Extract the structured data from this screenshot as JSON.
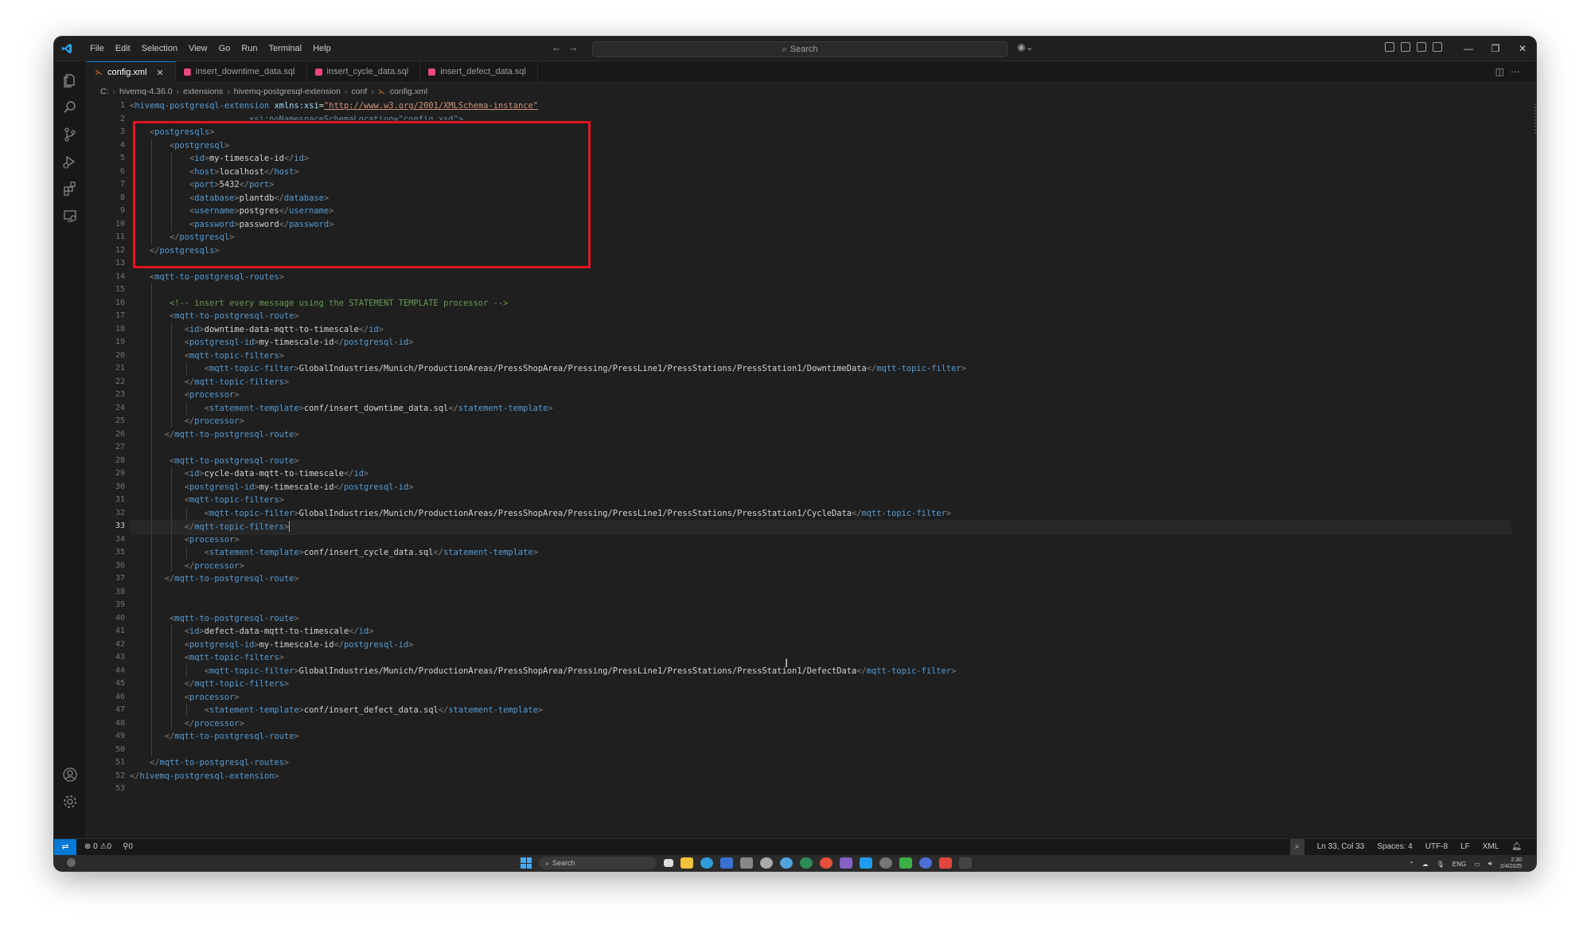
{
  "menu": [
    "File",
    "Edit",
    "Selection",
    "View",
    "Go",
    "Run",
    "Terminal",
    "Help"
  ],
  "search": {
    "label": "Search"
  },
  "tabs": [
    {
      "label": "config.xml",
      "type": "xml",
      "active": true
    },
    {
      "label": "insert_downtime_data.sql",
      "type": "sql",
      "active": false
    },
    {
      "label": "insert_cycle_data.sql",
      "type": "sql",
      "active": false
    },
    {
      "label": "insert_defect_data.sql",
      "type": "sql",
      "active": false
    }
  ],
  "breadcrumb": [
    "C:",
    "hivemq-4.36.0",
    "extensions",
    "hivemq-postgresql-extension",
    "conf",
    "config.xml"
  ],
  "editor": {
    "current_line": 33,
    "lines": [
      "1",
      "2",
      "3",
      "4",
      "5",
      "6",
      "7",
      "8",
      "9",
      "10",
      "11",
      "12",
      "13",
      "14",
      "15",
      "16",
      "17",
      "18",
      "19",
      "20",
      "21",
      "22",
      "23",
      "24",
      "25",
      "26",
      "27",
      "28",
      "29",
      "30",
      "31",
      "32",
      "33",
      "34",
      "35",
      "36",
      "37",
      "38",
      "39",
      "40",
      "41",
      "42",
      "43",
      "44",
      "45",
      "46",
      "47",
      "48",
      "49",
      "50",
      "51",
      "52",
      "53"
    ],
    "code": {
      "root_tag": "hivemq-postgresql-extension",
      "xmlns_attr": "xmlns:xsi",
      "xmlns_value": "\"http://www.w3.org/2001/XMLSchema-instance\"",
      "line2_partial": "xsi:noNamespaceSchemaLocation=\"config.xsd\">",
      "postgresqls": "postgresqls",
      "postgresql": "postgresql",
      "id_tag": "id",
      "id_value": "my-timescale-id",
      "host_tag": "host",
      "host_value": "localhost",
      "port_tag": "port",
      "port_value": "5432",
      "database_tag": "database",
      "database_value": "plantdb",
      "username_tag": "username",
      "username_value": "postgres",
      "password_tag": "password",
      "password_value": "password",
      "routes_tag": "mqtt-to-postgresql-routes",
      "comment": "<!-- insert every message using the STATEMENT TEMPLATE processor -->",
      "route_tag": "mqtt-to-postgresql-route",
      "pgid_tag": "postgresql-id",
      "filters_tag": "mqtt-topic-filters",
      "filter_tag": "mqtt-topic-filter",
      "processor_tag": "processor",
      "template_tag": "statement-template",
      "routes": [
        {
          "id": "downtime-data-mqtt-to-timescale",
          "topic": "GlobalIndustries/Munich/ProductionAreas/PressShopArea/Pressing/PressLine1/PressStations/PressStation1/DowntimeData",
          "template": "conf/insert_downtime_data.sql"
        },
        {
          "id": "cycle-data-mqtt-to-timescale",
          "topic": "GlobalIndustries/Munich/ProductionAreas/PressShopArea/Pressing/PressLine1/PressStations/PressStation1/CycleData",
          "template": "conf/insert_cycle_data.sql"
        },
        {
          "id": "defect-data-mqtt-to-timescale",
          "topic": "GlobalIndustries/Munich/ProductionAreas/PressShopArea/Pressing/PressLine1/PressStations/PressStation1/DefectData",
          "template": "conf/insert_defect_data.sql"
        }
      ]
    }
  },
  "statusbar": {
    "errors": "0",
    "warnings": "0",
    "ports": "0",
    "position": "Ln 33, Col 33",
    "spaces": "Spaces: 4",
    "encoding": "UTF-8",
    "eol": "LF",
    "language": "XML"
  },
  "taskbar": {
    "search": "Search",
    "lang": "ENG",
    "time": "2:30",
    "date": "2/4/2025"
  },
  "colors": {
    "highlight_box": "#e0141e",
    "accent": "#0078d4",
    "tag": "#569cd6",
    "attr": "#9cdcfe",
    "string": "#ce9178",
    "comment": "#6a9955"
  },
  "icons": [
    "explorer-icon",
    "search-icon",
    "source-control-icon",
    "run-debug-icon",
    "extensions-icon",
    "remote-explorer-icon",
    "account-icon",
    "settings-gear-icon"
  ]
}
